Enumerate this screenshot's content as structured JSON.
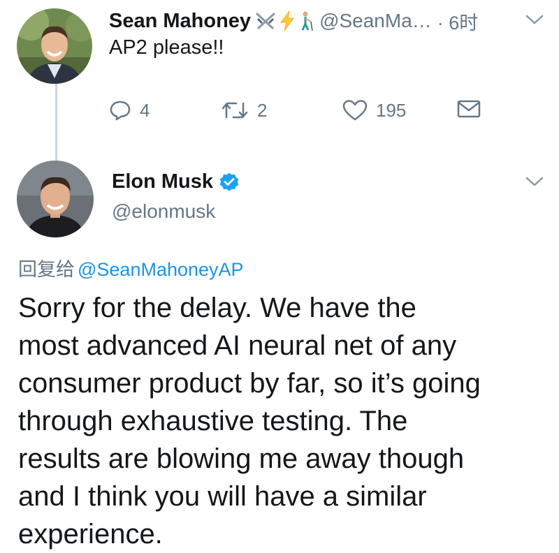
{
  "reply_tweet": {
    "author_name": "Sean Mahoney",
    "name_emojis": [
      "crossed-swords-emoji",
      "lightning-emoji",
      "golfer-emoji"
    ],
    "handle": "@SeanMa…",
    "time": "· 6时",
    "text": "AP2 please!!",
    "actions": {
      "reply_count": "4",
      "retweet_count": "2",
      "like_count": "195"
    }
  },
  "main_tweet": {
    "author_name": "Elon Musk",
    "handle": "@elonmusk",
    "verified": true,
    "replying_to_label": "回复给",
    "replying_to_mention": "@SeanMahoneyAP",
    "text": "Sorry for the delay. We have the\nmost advanced AI neural net of any\nconsumer product by far, so it’s going\nthrough exhaustive testing. The\nresults are blowing me away though\nand I think you will have a similar\nexperience."
  },
  "colors": {
    "text_primary": "#14171a",
    "text_secondary": "#657786",
    "link": "#1b95e0",
    "verified_badge": "#1da1f2",
    "thread_line": "#ccd6dd"
  }
}
